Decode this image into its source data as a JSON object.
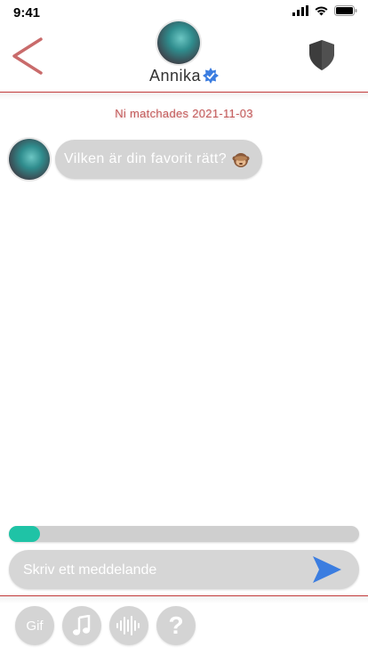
{
  "status_bar": {
    "time": "9:41"
  },
  "header": {
    "name": "Annika",
    "avatar": "profile-photo",
    "back_icon": "chevron-left-icon",
    "shield_icon": "shield-icon",
    "verified_icon": "verified-badge-icon"
  },
  "chat": {
    "match_info": "Ni matchades 2021-11-03",
    "messages": [
      {
        "text": "Vilken är din favorit rätt?",
        "emoji": "see-no-evil-monkey"
      }
    ]
  },
  "progress": {
    "value": 0.09,
    "color": "#1fc3a6"
  },
  "composer": {
    "placeholder": "Skriv ett meddelande",
    "send_icon": "send-arrow-icon"
  },
  "toolbar": {
    "gif_label": "Gif",
    "music_icon": "music-note-icon",
    "audio_icon": "audio-wave-icon",
    "question_label": "?"
  },
  "colors": {
    "accent": "#c23a3a",
    "send": "#3b7de0",
    "bubble": "#d4d4d4"
  }
}
